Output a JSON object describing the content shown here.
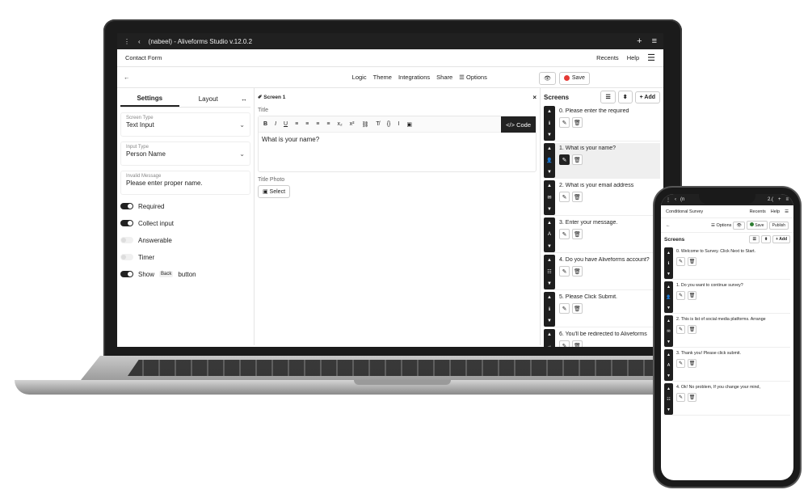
{
  "laptop": {
    "titlebar": {
      "menu_icon": "⋮",
      "back_icon": "‹",
      "title": "(nabeel) - Aliveforms Studio v.12.0.2",
      "plus": "+",
      "hamburger": "≡"
    },
    "appbar": {
      "form_name": "Contact Form",
      "recents": "Recents",
      "help": "Help",
      "menu": "☰"
    },
    "toolbar": {
      "back": "←",
      "links": [
        "Logic",
        "Theme",
        "Integrations",
        "Share"
      ],
      "options": "☰ Options",
      "preview_icon": "👁",
      "save": "Save"
    },
    "left": {
      "tabs": [
        "Settings",
        "Layout"
      ],
      "expand": "↔",
      "fields": [
        {
          "label": "Screen Type",
          "value": "Text Input",
          "chevron": "⌄"
        },
        {
          "label": "Input Type",
          "value": "Person Name",
          "chevron": "⌄"
        },
        {
          "label": "Invalid Message",
          "value": "Please enter proper name."
        }
      ],
      "toggles": [
        {
          "label": "Required",
          "on": true
        },
        {
          "label": "Collect input",
          "on": true
        },
        {
          "label": "Answerable",
          "on": false
        },
        {
          "label": "Timer",
          "on": false
        }
      ],
      "show_back": {
        "pre": "Show",
        "chip": "Back",
        "post": "button"
      }
    },
    "mid": {
      "tab": "✐ Screen 1",
      "close": "×",
      "title_label": "Title",
      "rte_tools": [
        "B",
        "I",
        "U",
        "≡",
        "≡",
        "≡",
        "≡",
        "x₂",
        "x²",
        "⛓",
        "T̸",
        "{}",
        "I",
        "▣"
      ],
      "code": "</> Code",
      "title_value": "What is your name?",
      "photo_label": "Title Photo",
      "select": "▣ Select"
    },
    "screens": {
      "heading": "Screens",
      "add": "+ Add",
      "sort": "☰",
      "updown": "⬍",
      "items": [
        "0. Please enter the required",
        "1. What is your name?",
        "2. What is your email address",
        "3. Enter your message.",
        "4. Do you have Aliveforms account?",
        "5. Please Click Submit.",
        "6. You'll be redirected to Aliveforms"
      ]
    }
  },
  "phone": {
    "titlebar": {
      "menu": "⋮",
      "back": "‹",
      "title": "(n",
      "ver": "2.(",
      "plus": "+",
      "hamburger": "≡"
    },
    "appbar": {
      "form_name": "Conditional Survey",
      "recents": "Recents",
      "help": "Help",
      "menu": "☰"
    },
    "toolbar": {
      "back": "←",
      "options": "☰ Options",
      "eye": "👁",
      "save": "Save",
      "publish": "Publish"
    },
    "screens": {
      "heading": "Screens",
      "sort": "☰",
      "updown": "⬍",
      "add": "+ Add",
      "items": [
        "0. Welcome to Survey. Click Next to Start.",
        "1. Do you want to continue survey?",
        "2. This is list of social media platforms. Arrange",
        "3. Thank you! Please click submit.",
        "4. Ok! No problem, If you change your mind,"
      ]
    }
  }
}
